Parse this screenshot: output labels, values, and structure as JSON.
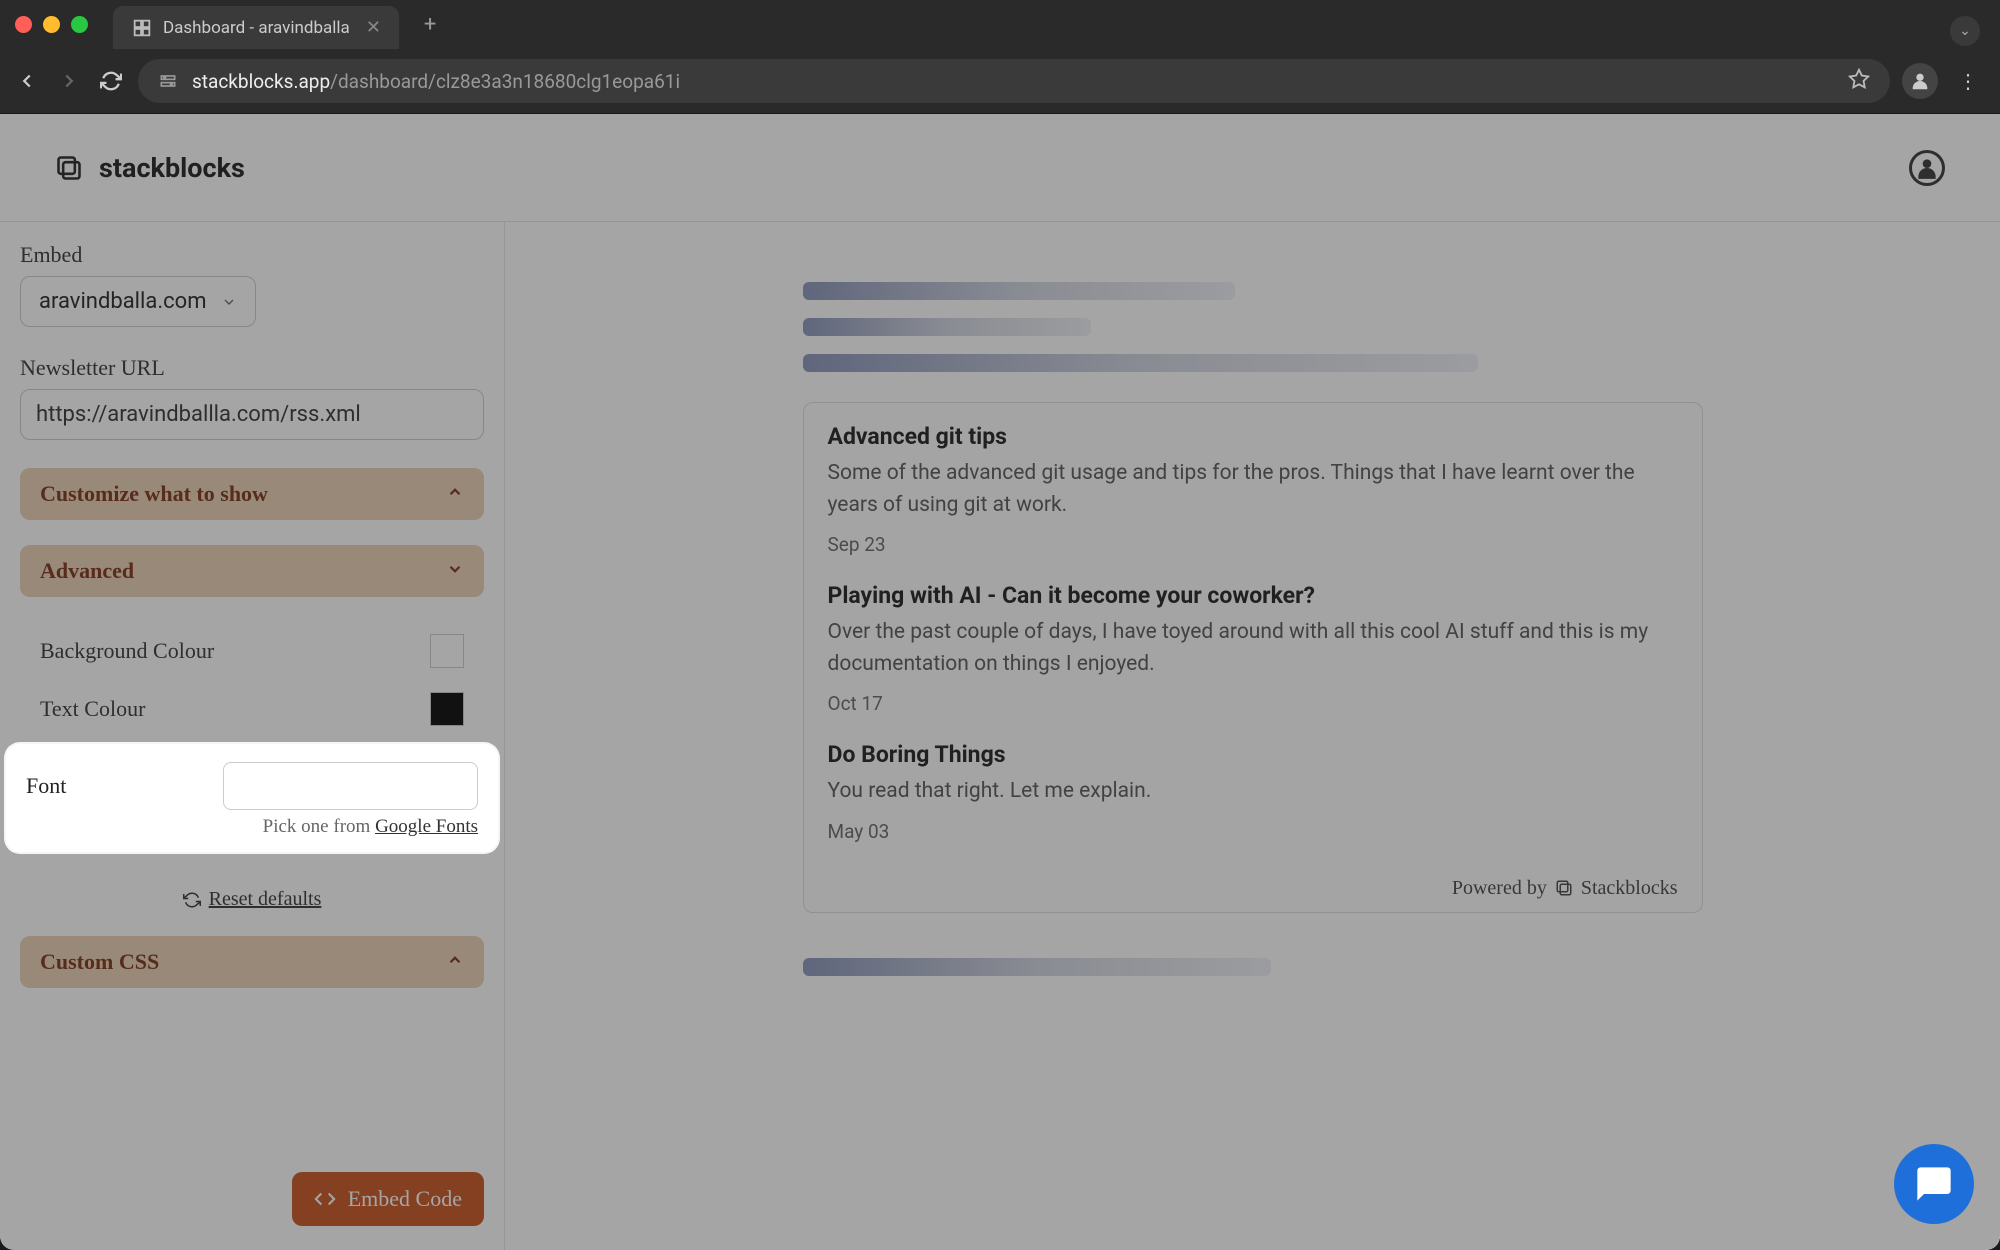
{
  "browser": {
    "tab_title": "Dashboard - aravindballa",
    "url_host": "stackblocks.app",
    "url_path": "/dashboard/clz8e3a3n18680clg1eopa61i"
  },
  "header": {
    "brand": "stackblocks"
  },
  "sidebar": {
    "embed_label": "Embed",
    "embed_value": "aravindballa.com",
    "url_label": "Newsletter URL",
    "url_value": "https://aravindballla.com/rss.xml",
    "section_customize": "Customize what to show",
    "section_advanced": "Advanced",
    "bg_color_label": "Background Colour",
    "text_color_label": "Text Colour",
    "font_label": "Font",
    "font_hint_prefix": "Pick one from ",
    "font_hint_link": "Google Fonts",
    "reset_label": "Reset defaults",
    "section_css": "Custom CSS",
    "embed_button": "Embed Code"
  },
  "preview": {
    "posts": [
      {
        "title": "Advanced git tips",
        "desc": "Some of the advanced git usage and tips for the pros. Things that I have learnt over the years of using git at work.",
        "date": "Sep 23"
      },
      {
        "title": "Playing with AI - Can it become your coworker?",
        "desc": "Over the past couple of days, I have toyed around with all this cool AI stuff and this is my documentation on things I enjoyed.",
        "date": "Oct 17"
      },
      {
        "title": "Do Boring Things",
        "desc": "You read that right. Let me explain.",
        "date": "May 03"
      }
    ],
    "powered_prefix": "Powered by",
    "powered_brand": "Stackblocks"
  }
}
